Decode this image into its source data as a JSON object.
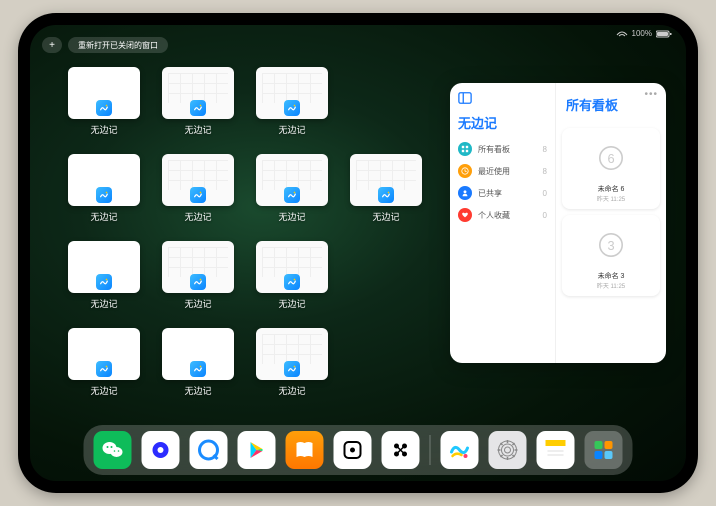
{
  "status": {
    "battery": "100%"
  },
  "topbar": {
    "plus": "+",
    "reopen": "重新打开已关闭的窗口"
  },
  "app": {
    "label": "无边记"
  },
  "windows": [
    {
      "detailed": false
    },
    {
      "detailed": true
    },
    {
      "detailed": true
    },
    null,
    {
      "detailed": false
    },
    {
      "detailed": true
    },
    {
      "detailed": true
    },
    {
      "detailed": true
    },
    {
      "detailed": false
    },
    {
      "detailed": true
    },
    {
      "detailed": true
    },
    null,
    {
      "detailed": false
    },
    {
      "detailed": false
    },
    {
      "detailed": true
    },
    null
  ],
  "panel": {
    "left_title": "无边记",
    "right_title": "所有看板",
    "nav": [
      {
        "icon": "grid",
        "color": "#1fb8c6",
        "label": "所有看板",
        "count": "8"
      },
      {
        "icon": "clock",
        "color": "#ff9f0a",
        "label": "最近使用",
        "count": "8"
      },
      {
        "icon": "person",
        "color": "#1a7aff",
        "label": "已共享",
        "count": "0"
      },
      {
        "icon": "heart",
        "color": "#ff3b30",
        "label": "个人收藏",
        "count": "0"
      }
    ],
    "boards": [
      {
        "label": "未命名 6",
        "sub": "昨天 11:25",
        "num": "6"
      },
      {
        "label": "未命名 3",
        "sub": "昨天 11:25",
        "num": "3"
      }
    ]
  },
  "dock": {
    "apps": [
      {
        "name": "wechat",
        "bg": "#0ebc5a"
      },
      {
        "name": "quark",
        "bg": "#fff"
      },
      {
        "name": "browser-q",
        "bg": "#fff"
      },
      {
        "name": "play",
        "bg": "#fff"
      },
      {
        "name": "books",
        "bg": "#ff9500"
      },
      {
        "name": "dice",
        "bg": "#fff"
      },
      {
        "name": "dots",
        "bg": "#fff"
      },
      {
        "name": "freeform",
        "bg": "#fff"
      },
      {
        "name": "settings",
        "bg": "#e5e5e7"
      },
      {
        "name": "notes",
        "bg": "#fff"
      }
    ]
  }
}
